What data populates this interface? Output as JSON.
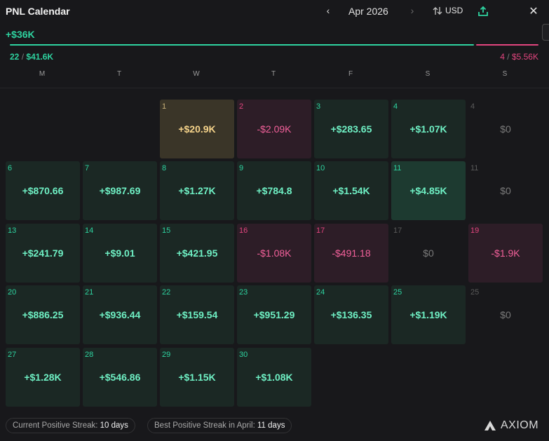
{
  "header": {
    "title": "PNL Calendar",
    "prev_label": "‹",
    "month": "Apr 2026",
    "next_label": "›",
    "currency": "USD",
    "close_label": "✕"
  },
  "summary": {
    "total": "+$36K",
    "win_days": "22",
    "win_amount": "$41.6K",
    "loss_days": "4",
    "loss_amount": "$5.56K",
    "separator": "/"
  },
  "weekdays": [
    "M",
    "T",
    "W",
    "T",
    "F",
    "S",
    "S"
  ],
  "days": [
    {
      "day": "1",
      "value": "+$20.9K",
      "kind": "gold",
      "row": 0,
      "col": 2
    },
    {
      "day": "2",
      "value": "-$2.09K",
      "kind": "neg",
      "row": 0,
      "col": 3
    },
    {
      "day": "3",
      "value": "+$283.65",
      "kind": "pos",
      "row": 0,
      "col": 4
    },
    {
      "day": "4",
      "value": "+$1.07K",
      "kind": "pos",
      "row": 0,
      "col": 5
    },
    {
      "day": "4",
      "value": "$0",
      "kind": "zero",
      "row": 0,
      "col": 6
    },
    {
      "day": "6",
      "value": "+$870.66",
      "kind": "pos",
      "row": 1,
      "col": 0
    },
    {
      "day": "7",
      "value": "+$987.69",
      "kind": "pos",
      "row": 1,
      "col": 1
    },
    {
      "day": "8",
      "value": "+$1.27K",
      "kind": "pos",
      "row": 1,
      "col": 2
    },
    {
      "day": "9",
      "value": "+$784.8",
      "kind": "pos",
      "row": 1,
      "col": 3
    },
    {
      "day": "10",
      "value": "+$1.54K",
      "kind": "pos",
      "row": 1,
      "col": 4
    },
    {
      "day": "11",
      "value": "+$4.85K",
      "kind": "pos2",
      "row": 1,
      "col": 5
    },
    {
      "day": "11",
      "value": "$0",
      "kind": "zero",
      "row": 1,
      "col": 6
    },
    {
      "day": "13",
      "value": "+$241.79",
      "kind": "pos",
      "row": 2,
      "col": 0
    },
    {
      "day": "14",
      "value": "+$9.01",
      "kind": "pos",
      "row": 2,
      "col": 1
    },
    {
      "day": "15",
      "value": "+$421.95",
      "kind": "pos",
      "row": 2,
      "col": 2
    },
    {
      "day": "16",
      "value": "-$1.08K",
      "kind": "neg",
      "row": 2,
      "col": 3
    },
    {
      "day": "17",
      "value": "-$491.18",
      "kind": "neg",
      "row": 2,
      "col": 4
    },
    {
      "day": "17",
      "value": "$0",
      "kind": "zero",
      "row": 2,
      "col": 5
    },
    {
      "day": "19",
      "value": "-$1.9K",
      "kind": "neg",
      "row": 2,
      "col": 6
    },
    {
      "day": "20",
      "value": "+$886.25",
      "kind": "pos",
      "row": 3,
      "col": 0
    },
    {
      "day": "21",
      "value": "+$936.44",
      "kind": "pos",
      "row": 3,
      "col": 1
    },
    {
      "day": "22",
      "value": "+$159.54",
      "kind": "pos",
      "row": 3,
      "col": 2
    },
    {
      "day": "23",
      "value": "+$951.29",
      "kind": "pos",
      "row": 3,
      "col": 3
    },
    {
      "day": "24",
      "value": "+$136.35",
      "kind": "pos",
      "row": 3,
      "col": 4
    },
    {
      "day": "25",
      "value": "+$1.19K",
      "kind": "pos",
      "row": 3,
      "col": 5
    },
    {
      "day": "25",
      "value": "$0",
      "kind": "zero",
      "row": 3,
      "col": 6
    },
    {
      "day": "27",
      "value": "+$1.28K",
      "kind": "pos",
      "row": 4,
      "col": 0
    },
    {
      "day": "28",
      "value": "+$546.86",
      "kind": "pos",
      "row": 4,
      "col": 1
    },
    {
      "day": "29",
      "value": "+$1.15K",
      "kind": "pos",
      "row": 4,
      "col": 2
    },
    {
      "day": "30",
      "value": "+$1.08K",
      "kind": "pos",
      "row": 4,
      "col": 3
    }
  ],
  "footer": {
    "current_streak_label": "Current Positive Streak:",
    "current_streak_value": "10 days",
    "best_streak_label": "Best Positive Streak in April:",
    "best_streak_value": "11 days",
    "brand": "AXIOM"
  },
  "colors": {
    "positive": "#2ed3a0",
    "negative": "#e2457e",
    "background": "#18181b"
  }
}
